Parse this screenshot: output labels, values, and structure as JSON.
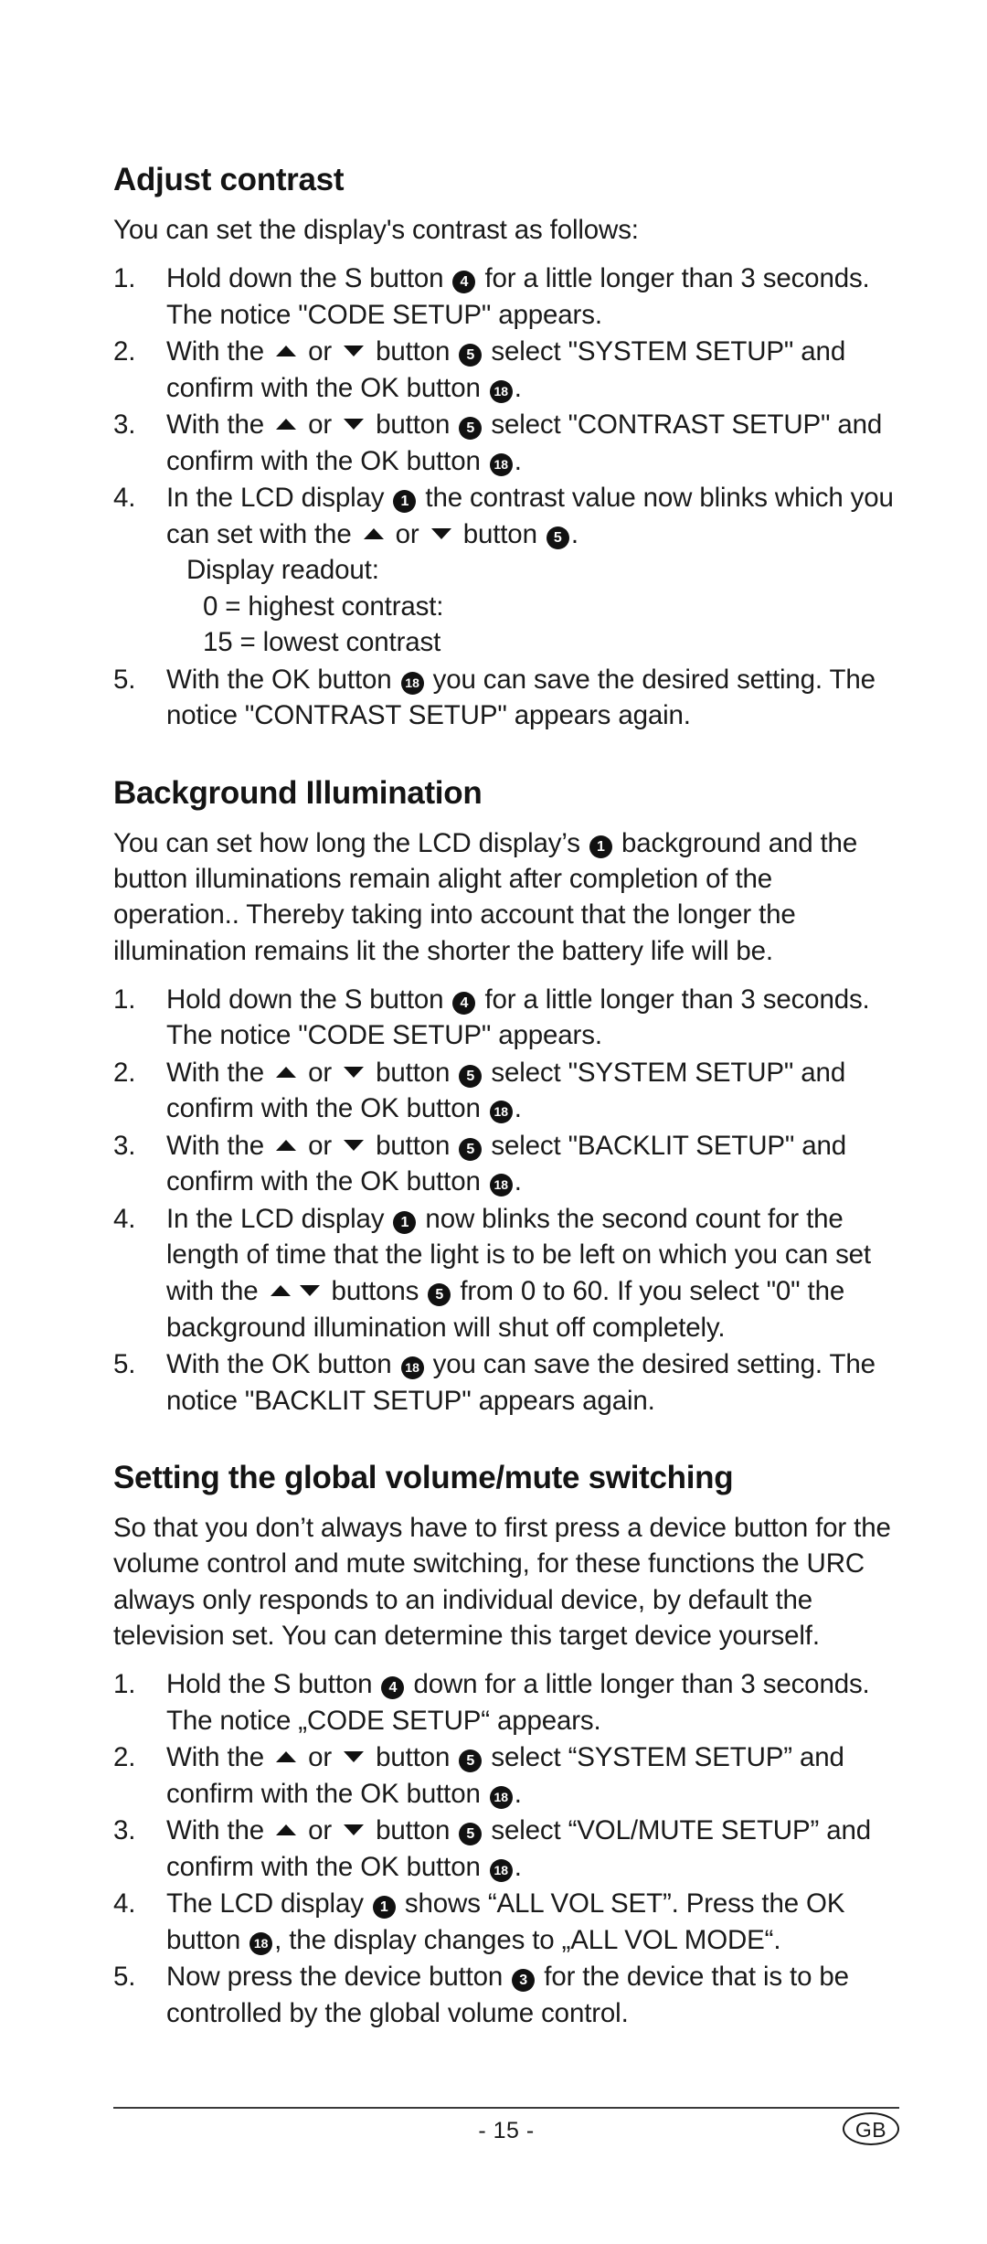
{
  "document": {
    "language_badge": "GB",
    "page_number": "- 15 -"
  },
  "sections": [
    {
      "id": "adjust-contrast",
      "heading": "Adjust contrast",
      "intro": "You can set the display's contrast as follows:",
      "steps": [
        {
          "num": "1.",
          "parts": [
            {
              "t": "text",
              "v": "Hold down the S button "
            },
            {
              "t": "badge",
              "v": "4"
            },
            {
              "t": "text",
              "v": " for a little longer than 3 seconds. The notice \"CODE SETUP\" appears."
            }
          ]
        },
        {
          "num": "2.",
          "parts": [
            {
              "t": "text",
              "v": "With the "
            },
            {
              "t": "tri-up"
            },
            {
              "t": "text",
              "v": " or "
            },
            {
              "t": "tri-down"
            },
            {
              "t": "text",
              "v": " button "
            },
            {
              "t": "badge",
              "v": "5"
            },
            {
              "t": "text",
              "v": " select \"SYSTEM SETUP\" and confirm with the OK button "
            },
            {
              "t": "badge",
              "v": "18"
            },
            {
              "t": "text",
              "v": "."
            }
          ]
        },
        {
          "num": "3.",
          "parts": [
            {
              "t": "text",
              "v": "With the "
            },
            {
              "t": "tri-up"
            },
            {
              "t": "text",
              "v": " or "
            },
            {
              "t": "tri-down"
            },
            {
              "t": "text",
              "v": " button "
            },
            {
              "t": "badge",
              "v": "5"
            },
            {
              "t": "text",
              "v": " select \"CONTRAST SETUP\" and confirm with the OK button "
            },
            {
              "t": "badge",
              "v": "18"
            },
            {
              "t": "text",
              "v": "."
            }
          ]
        },
        {
          "num": "4.",
          "parts": [
            {
              "t": "text",
              "v": "In the LCD display "
            },
            {
              "t": "badge",
              "v": "1"
            },
            {
              "t": "text",
              "v": " the contrast value now blinks which you can set with the "
            },
            {
              "t": "tri-up"
            },
            {
              "t": "text",
              "v": " or "
            },
            {
              "t": "tri-down"
            },
            {
              "t": "text",
              "v": " button "
            },
            {
              "t": "badge",
              "v": "5"
            },
            {
              "t": "text",
              "v": "."
            },
            {
              "t": "br"
            },
            {
              "t": "text",
              "v": "Display readout:"
            },
            {
              "t": "br2"
            },
            {
              "t": "text",
              "v": "0 = highest contrast:"
            },
            {
              "t": "br2"
            },
            {
              "t": "text",
              "v": "15 = lowest contrast"
            }
          ]
        },
        {
          "num": "5.",
          "parts": [
            {
              "t": "text",
              "v": "With the OK button "
            },
            {
              "t": "badge",
              "v": "18"
            },
            {
              "t": "text",
              "v": " you can save the desired setting. The notice \"CONTRAST SETUP\" appears again."
            }
          ]
        }
      ]
    },
    {
      "id": "background-illumination",
      "heading": "Background Illumination",
      "intro_parts": [
        {
          "t": "text",
          "v": "You can set how long the LCD display’s "
        },
        {
          "t": "badge",
          "v": "1"
        },
        {
          "t": "text",
          "v": " background and the button illuminations remain alight after completion of the operation.. Thereby taking into account that the longer the illumination remains lit the shorter the battery life will be."
        }
      ],
      "steps": [
        {
          "num": "1.",
          "parts": [
            {
              "t": "text",
              "v": "Hold down the S button "
            },
            {
              "t": "badge",
              "v": "4"
            },
            {
              "t": "text",
              "v": " for a little longer than 3 seconds. The notice \"CODE SETUP\" appears."
            }
          ]
        },
        {
          "num": "2.",
          "parts": [
            {
              "t": "text",
              "v": "With the "
            },
            {
              "t": "tri-up"
            },
            {
              "t": "text",
              "v": " or "
            },
            {
              "t": "tri-down"
            },
            {
              "t": "text",
              "v": " button "
            },
            {
              "t": "badge",
              "v": "5"
            },
            {
              "t": "text",
              "v": " select \"SYSTEM SETUP\" and confirm with the OK button "
            },
            {
              "t": "badge",
              "v": "18"
            },
            {
              "t": "text",
              "v": "."
            }
          ]
        },
        {
          "num": "3.",
          "parts": [
            {
              "t": "text",
              "v": "With the "
            },
            {
              "t": "tri-up"
            },
            {
              "t": "text",
              "v": " or "
            },
            {
              "t": "tri-down"
            },
            {
              "t": "text",
              "v": " button "
            },
            {
              "t": "badge",
              "v": "5"
            },
            {
              "t": "text",
              "v": " select \"BACKLIT SETUP\" and confirm with the OK button "
            },
            {
              "t": "badge",
              "v": "18"
            },
            {
              "t": "text",
              "v": "."
            }
          ]
        },
        {
          "num": "4.",
          "parts": [
            {
              "t": "text",
              "v": "In the LCD display "
            },
            {
              "t": "badge",
              "v": "1"
            },
            {
              "t": "text",
              "v": " now blinks the second count for the length of time that the light is to be left on which you can set with the "
            },
            {
              "t": "tri-up"
            },
            {
              "t": "tri-down"
            },
            {
              "t": "text",
              "v": " buttons "
            },
            {
              "t": "badge",
              "v": "5"
            },
            {
              "t": "text",
              "v": " from 0 to 60. If you select \"0\" the background illumination will shut off completely."
            }
          ]
        },
        {
          "num": "5.",
          "parts": [
            {
              "t": "text",
              "v": "With the OK button "
            },
            {
              "t": "badge",
              "v": "18"
            },
            {
              "t": "text",
              "v": " you can save the desired setting. The notice \"BACKLIT SETUP\" appears again."
            }
          ]
        }
      ]
    },
    {
      "id": "global-volume-mute",
      "heading": "Setting the global volume/mute switching",
      "intro": "So that you don’t always have to first press a device button for the volume control and mute switching, for these functions the URC always only responds to an individual device, by default the television set. You can determine this target device yourself.",
      "steps": [
        {
          "num": "1.",
          "parts": [
            {
              "t": "text",
              "v": "Hold the S button "
            },
            {
              "t": "badge",
              "v": "4"
            },
            {
              "t": "text",
              "v": " down for a little longer than 3 seconds. The notice „CODE SETUP“ appears."
            }
          ]
        },
        {
          "num": "2.",
          "parts": [
            {
              "t": "text",
              "v": "With the "
            },
            {
              "t": "tri-up"
            },
            {
              "t": "text",
              "v": " or "
            },
            {
              "t": "tri-down"
            },
            {
              "t": "text",
              "v": " button "
            },
            {
              "t": "badge",
              "v": "5"
            },
            {
              "t": "text",
              "v": " select “SYSTEM SETUP” and confirm with the OK button "
            },
            {
              "t": "badge",
              "v": "18"
            },
            {
              "t": "text",
              "v": "."
            }
          ]
        },
        {
          "num": "3.",
          "parts": [
            {
              "t": "text",
              "v": "With the "
            },
            {
              "t": "tri-up"
            },
            {
              "t": "text",
              "v": " or "
            },
            {
              "t": "tri-down"
            },
            {
              "t": "text",
              "v": " button "
            },
            {
              "t": "badge",
              "v": "5"
            },
            {
              "t": "text",
              "v": " select “VOL/MUTE SETUP” and confirm with the OK button "
            },
            {
              "t": "badge",
              "v": "18"
            },
            {
              "t": "text",
              "v": "."
            }
          ]
        },
        {
          "num": "4.",
          "parts": [
            {
              "t": "text",
              "v": "The LCD display "
            },
            {
              "t": "badge",
              "v": "1"
            },
            {
              "t": "text",
              "v": " shows “ALL VOL SET”. Press the OK button "
            },
            {
              "t": "badge",
              "v": "18"
            },
            {
              "t": "text",
              "v": ", the display changes to „ALL VOL MODE“."
            }
          ]
        },
        {
          "num": "5.",
          "parts": [
            {
              "t": "text",
              "v": "Now press the device button "
            },
            {
              "t": "badge",
              "v": "3"
            },
            {
              "t": "text",
              "v": " for the device that is to be controlled by the global volume control."
            }
          ]
        }
      ]
    }
  ]
}
